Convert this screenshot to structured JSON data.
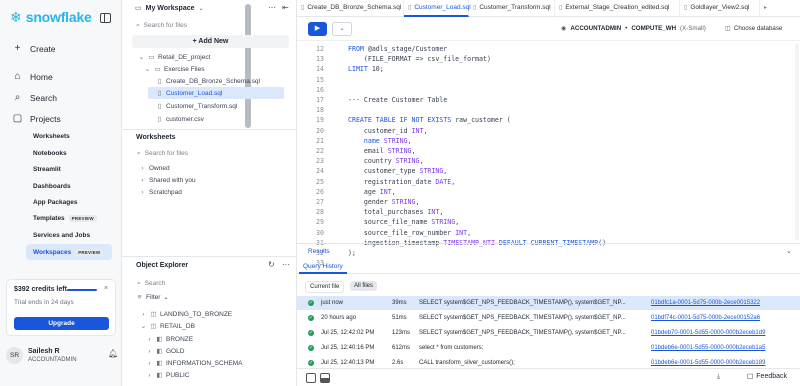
{
  "nav": {
    "brand": "snowflake",
    "create": "Create",
    "home": "Home",
    "search": "Search",
    "projects": "Projects",
    "project_items": [
      "Worksheets",
      "Notebooks",
      "Streamlit",
      "Dashboards",
      "App Packages"
    ],
    "templates": "Templates",
    "templates_badge": "PREVIEW",
    "services": "Services and Jobs",
    "services_active": "Services and Jobs",
    "workspaces": "Workspaces",
    "workspaces_badge": "PREVIEW",
    "credits": "$392 credits left",
    "trial": "Trial ends in 24 days",
    "upgrade": "Upgrade",
    "user_initials": "SR",
    "user_name": "Sailesh R",
    "user_role": "ACCOUNTADMIN"
  },
  "files": {
    "workspace": "My Workspace",
    "search_placeholder": "Search for files",
    "add_new": "+ Add New",
    "tree": [
      {
        "label": "Retail_DE_project",
        "icon": "folder"
      },
      {
        "label": "Exercise Files",
        "icon": "folder"
      },
      {
        "label": "Create_DB_Bronze_Schema.sql",
        "icon": "file"
      },
      {
        "label": "Customer_Load.sql",
        "icon": "file"
      },
      {
        "label": "Customer_Transform.sql",
        "icon": "file"
      },
      {
        "label": "customer.csv",
        "icon": "file"
      }
    ],
    "worksheets_title": "Worksheets",
    "worksheets_search": "Search for files",
    "worksheet_items": [
      "Owned",
      "Shared with you",
      "Scratchpad"
    ],
    "explorer_title": "Object Explorer",
    "explorer_search": "Search",
    "filter": "Filter",
    "objects": [
      {
        "label": "LANDING_TO_BRONZE",
        "level": 0
      },
      {
        "label": "RETAIL_DB",
        "level": 0
      },
      {
        "label": "BRONZE",
        "level": 1
      },
      {
        "label": "GOLD",
        "level": 1
      },
      {
        "label": "INFORMATION_SCHEMA",
        "level": 1
      },
      {
        "label": "PUBLIC",
        "level": 1
      }
    ]
  },
  "tabs": [
    {
      "label": "Create_DB_Bronze_Schema.sql",
      "active": false
    },
    {
      "label": "Customer_Load.sql",
      "active": true
    },
    {
      "label": "Customer_Transform.sql",
      "active": false
    },
    {
      "label": "External_Stage_Creation_edited.sql",
      "active": false
    },
    {
      "label": "Goldlayer_View2.sql",
      "active": false
    }
  ],
  "toolbar": {
    "role": "ACCOUNTADMIN",
    "warehouse": "COMPUTE_WH",
    "warehouse_size": "(X-Small)",
    "choose_db": "Choose database"
  },
  "editor": {
    "lines": [
      {
        "n": "12",
        "parts": [
          [
            "kw",
            "FROM "
          ],
          [
            "cm",
            "@adls_stage/Customer"
          ]
        ]
      },
      {
        "n": "13",
        "parts": [
          [
            "cm",
            "    (FILE_FORMAT => csv_file_format)"
          ]
        ]
      },
      {
        "n": "14",
        "parts": [
          [
            "kw",
            "LIMIT "
          ],
          [
            "cm",
            "10;"
          ]
        ]
      },
      {
        "n": "15",
        "parts": []
      },
      {
        "n": "16",
        "parts": []
      },
      {
        "n": "17",
        "parts": [
          [
            "cm",
            "--- Create Customer Table"
          ]
        ]
      },
      {
        "n": "18",
        "parts": []
      },
      {
        "n": "19",
        "parts": [
          [
            "kw",
            "CREATE TABLE IF NOT EXISTS "
          ],
          [
            "cm",
            "raw_customer ("
          ]
        ]
      },
      {
        "n": "20",
        "parts": [
          [
            "cm",
            "    customer_id "
          ],
          [
            "tp",
            "INT"
          ],
          [
            "cm",
            ","
          ]
        ]
      },
      {
        "n": "21",
        "parts": [
          [
            "cm",
            "    "
          ],
          [
            "kw",
            "name "
          ],
          [
            "tp",
            "STRING"
          ],
          [
            "cm",
            ","
          ]
        ]
      },
      {
        "n": "22",
        "parts": [
          [
            "cm",
            "    email "
          ],
          [
            "tp",
            "STRING"
          ],
          [
            "cm",
            ","
          ]
        ]
      },
      {
        "n": "23",
        "parts": [
          [
            "cm",
            "    country "
          ],
          [
            "tp",
            "STRING"
          ],
          [
            "cm",
            ","
          ]
        ]
      },
      {
        "n": "24",
        "parts": [
          [
            "cm",
            "    customer_type "
          ],
          [
            "tp",
            "STRING"
          ],
          [
            "cm",
            ","
          ]
        ]
      },
      {
        "n": "25",
        "parts": [
          [
            "cm",
            "    registration_date "
          ],
          [
            "tp",
            "DATE"
          ],
          [
            "cm",
            ","
          ]
        ]
      },
      {
        "n": "26",
        "parts": [
          [
            "cm",
            "    age "
          ],
          [
            "tp",
            "INT"
          ],
          [
            "cm",
            ","
          ]
        ]
      },
      {
        "n": "27",
        "parts": [
          [
            "cm",
            "    gender "
          ],
          [
            "tp",
            "STRING"
          ],
          [
            "cm",
            ","
          ]
        ]
      },
      {
        "n": "28",
        "parts": [
          [
            "cm",
            "    total_purchases "
          ],
          [
            "tp",
            "INT"
          ],
          [
            "cm",
            ","
          ]
        ]
      },
      {
        "n": "29",
        "parts": [
          [
            "cm",
            "    source_file_name "
          ],
          [
            "tp",
            "STRING"
          ],
          [
            "cm",
            ","
          ]
        ]
      },
      {
        "n": "30",
        "parts": [
          [
            "cm",
            "    source_file_row_number "
          ],
          [
            "tp",
            "INT"
          ],
          [
            "cm",
            ","
          ]
        ]
      },
      {
        "n": "31",
        "parts": [
          [
            "cm",
            "    ingestion_timestamp "
          ],
          [
            "tp",
            "TIMESTAMP_NTZ"
          ],
          [
            "kw",
            " DEFAULT CURRENT_TIMESTAMP"
          ],
          [
            "cm",
            "()"
          ]
        ]
      },
      {
        "n": "32",
        "parts": [
          [
            "cm",
            ");"
          ]
        ]
      },
      {
        "n": "33",
        "parts": []
      }
    ]
  },
  "results_label": "Results",
  "query_history": {
    "title": "Query History",
    "filters": [
      "Current file",
      "All files"
    ],
    "rows": [
      {
        "time": "just now",
        "dur": "39ms",
        "sql": "SELECT system$GET_NPS_FEEDBACK_TIMESTAMP(), system$GET_NP...",
        "id": "01bdfc1a-0001-5d75-000b-2ece0015322"
      },
      {
        "time": "20 hours ago",
        "dur": "51ms",
        "sql": "SELECT system$GET_NPS_FEEDBACK_TIMESTAMP(), system$GET_NP...",
        "id": "01bdf74c-0001-5d75-000b-2ece00152a6"
      },
      {
        "time": "Jul 25, 12:42:02 PM",
        "dur": "123ms",
        "sql": "SELECT system$GET_NPS_FEEDBACK_TIMESTAMP(), system$GET_NP...",
        "id": "01bdeb70-0001-5d55-0000-000b2eceb1d9"
      },
      {
        "time": "Jul 25, 12:40:16 PM",
        "dur": "612ms",
        "sql": "select * from customers;",
        "id": "01bdeb6e-0001-5d55-0000-000b2eceb1a5"
      },
      {
        "time": "Jul 25, 12:40:13 PM",
        "dur": "2.6s",
        "sql": "CALL transform_silver_customers();",
        "id": "01bdeb6e-0001-5d55-0000-000b2eceb189"
      }
    ]
  },
  "feedback": "Feedback"
}
